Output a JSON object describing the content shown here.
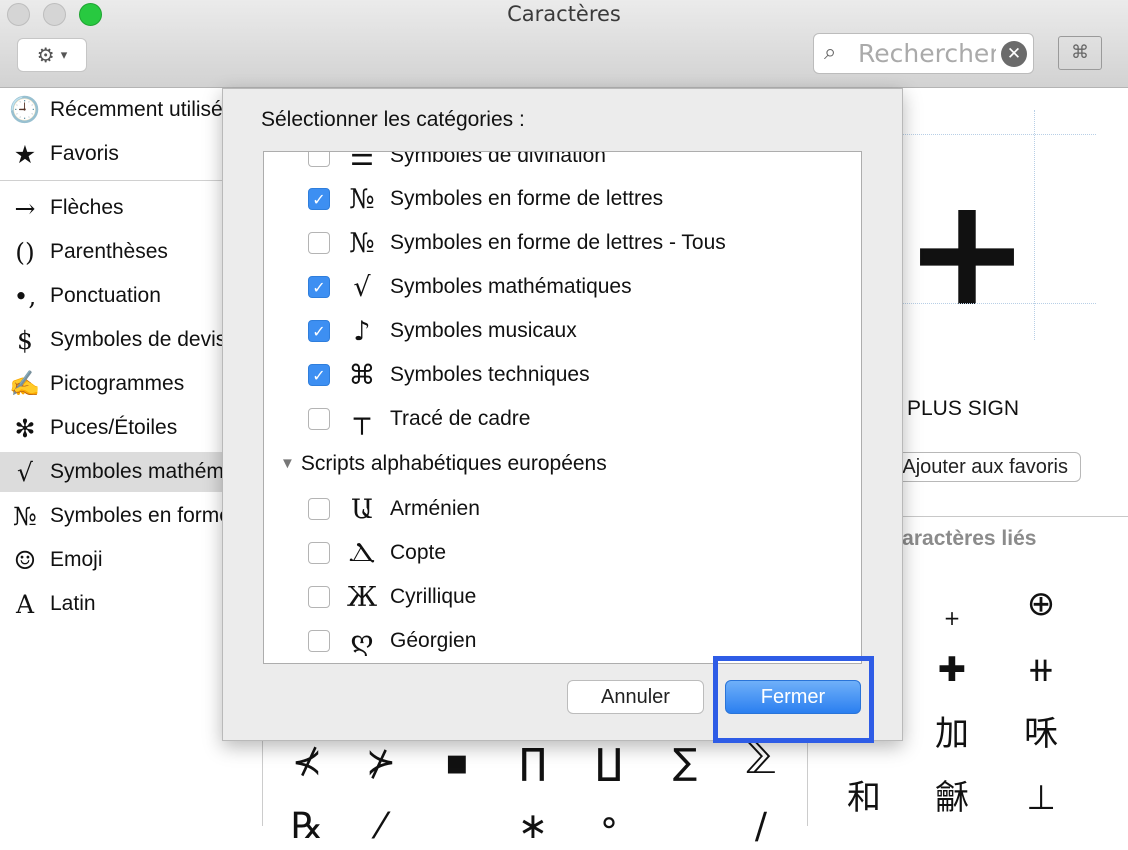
{
  "window": {
    "title": "Caractères"
  },
  "toolbar": {
    "gear_icon": "⚙",
    "chevron_icon": "⌄",
    "search_placeholder": "Rechercher",
    "search_icon": "⚲",
    "clear_icon": "✕",
    "keyboard_icon": "⌘"
  },
  "sidebar": {
    "items": [
      {
        "icon": "🕘",
        "label": "Récemment utilisés"
      },
      {
        "icon": "★",
        "label": "Favoris"
      },
      {
        "icon": "→",
        "label": "Flèches"
      },
      {
        "icon": "()",
        "label": "Parenthèses"
      },
      {
        "icon": "•,",
        "label": "Ponctuation"
      },
      {
        "icon": "$",
        "label": "Symboles de devise"
      },
      {
        "icon": "✍",
        "label": "Pictogrammes"
      },
      {
        "icon": "✻",
        "label": "Puces/Étoiles"
      },
      {
        "icon": "√",
        "label": "Symboles mathématiques"
      },
      {
        "icon": "№",
        "label": "Symboles en forme de lettres"
      },
      {
        "icon": "☺",
        "label": "Emoji"
      },
      {
        "icon": "A",
        "label": "Latin"
      }
    ]
  },
  "detail": {
    "glyph": "+",
    "name": "PLUS SIGN",
    "fav_button": "Ajouter aux favoris",
    "related_title": "Caractères liés",
    "related": [
      "+",
      "⊕",
      "✚",
      "⧺",
      "加",
      "咊",
      "和",
      "龢",
      "⊥"
    ]
  },
  "grid": {
    "row1": [
      "⊀",
      "⊁",
      "▪",
      "∏",
      "∐",
      "∑",
      "⅀"
    ],
    "row2": [
      "℞",
      "⁄",
      "∗",
      "∘",
      "∕"
    ]
  },
  "dialog": {
    "title": "Sélectionner les catégories :",
    "rows": [
      {
        "icon": "☰",
        "label": "Symboles de divination",
        "checked": false
      },
      {
        "icon": "№",
        "label": "Symboles en forme de lettres",
        "checked": true
      },
      {
        "icon": "№",
        "label": "Symboles en forme de lettres - Tous",
        "checked": false
      },
      {
        "icon": "√",
        "label": "Symboles mathématiques",
        "checked": true
      },
      {
        "icon": "♪",
        "label": "Symboles musicaux",
        "checked": true
      },
      {
        "icon": "⌘",
        "label": "Symboles techniques",
        "checked": true
      },
      {
        "icon": "┬",
        "label": "Tracé de cadre",
        "checked": false
      }
    ],
    "group": {
      "toggle_icon": "▼",
      "label": "Scripts alphabétiques européens"
    },
    "group_rows": [
      {
        "icon": "Ա",
        "label": "Arménien",
        "checked": false
      },
      {
        "icon": "Ⲇ",
        "label": "Copte",
        "checked": false
      },
      {
        "icon": "Ж",
        "label": "Cyrillique",
        "checked": false
      },
      {
        "icon": "ღ",
        "label": "Géorgien",
        "checked": false
      }
    ],
    "check_glyph": "✓",
    "cancel_label": "Annuler",
    "ok_label": "Fermer"
  }
}
